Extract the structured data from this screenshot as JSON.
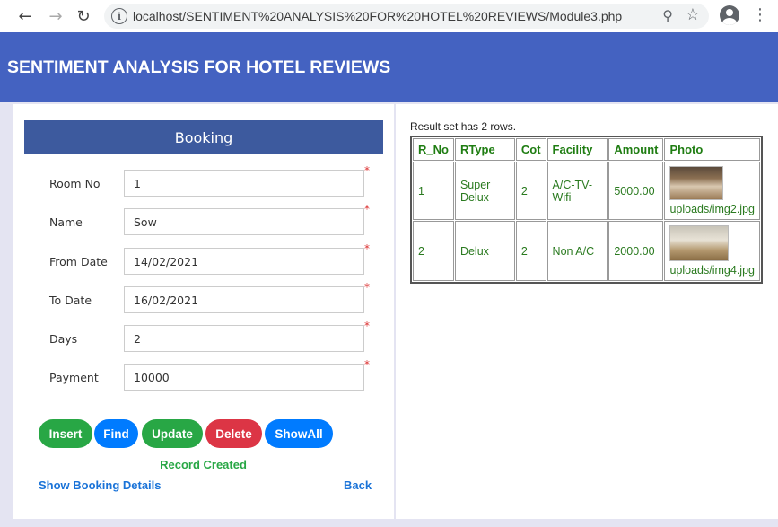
{
  "browser": {
    "url": "localhost/SENTIMENT%20ANALYSIS%20FOR%20HOTEL%20REVIEWS/Module3.php"
  },
  "header": {
    "title": "SENTIMENT ANALYSIS FOR HOTEL REVIEWS"
  },
  "booking": {
    "title": "Booking",
    "required_mark": "*",
    "fields": [
      {
        "label": "Room No",
        "value": "1"
      },
      {
        "label": "Name",
        "value": "Sow"
      },
      {
        "label": "From Date",
        "value": "14/02/2021"
      },
      {
        "label": "To Date",
        "value": "16/02/2021"
      },
      {
        "label": "Days",
        "value": "2"
      },
      {
        "label": "Payment",
        "value": "10000"
      }
    ],
    "buttons": {
      "insert": "Insert",
      "find": "Find",
      "update": "Update",
      "delete": "Delete",
      "showall": "ShowAll"
    },
    "status": "Record Created",
    "links": {
      "show_details": "Show Booking Details",
      "back": "Back"
    }
  },
  "results": {
    "caption": "Result set has 2 rows.",
    "columns": [
      "R_No",
      "RType",
      "Cot",
      "Facility",
      "Amount",
      "Photo"
    ],
    "rows": [
      {
        "r_no": "1",
        "rtype": "Super Delux",
        "cot": "2",
        "facility": "A/C-TV-Wifi",
        "amount": "5000.00",
        "photo": "uploads/img2.jpg"
      },
      {
        "r_no": "2",
        "rtype": "Delux",
        "cot": "2",
        "facility": "Non A/C",
        "amount": "2000.00",
        "photo": "uploads/img4.jpg"
      }
    ]
  },
  "colors": {
    "header_bg": "#4462c1",
    "booking_bar": "#3d5a9e",
    "green": "#28a745",
    "blue": "#007bff",
    "red": "#dc3545"
  }
}
